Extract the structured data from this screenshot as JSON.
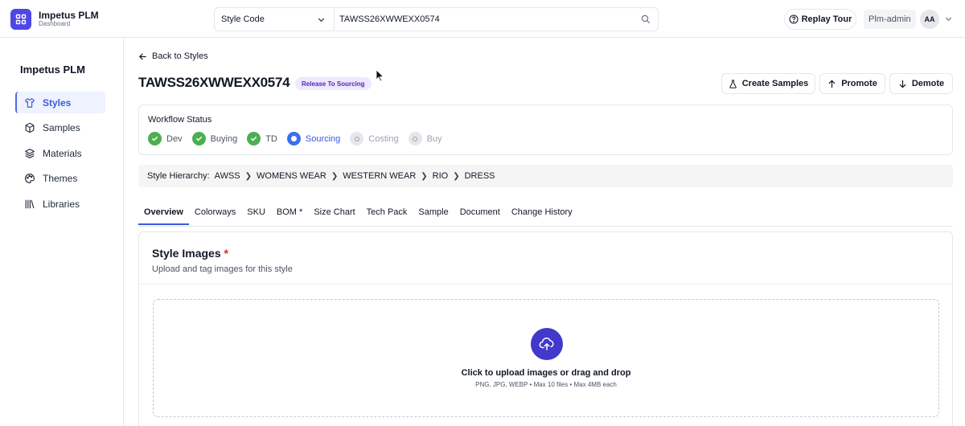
{
  "app": {
    "title": "Impetus PLM",
    "subtitle": "Dashboard"
  },
  "search": {
    "type_selected": "Style Code",
    "value": "TAWSS26XWWEXX0574"
  },
  "header": {
    "replay_tour": "Replay Tour",
    "user_role": "Plm-admin",
    "avatar_initials": "AA"
  },
  "sidebar": {
    "title": "Impetus PLM",
    "items": [
      {
        "label": "Styles",
        "icon": "shirt-icon",
        "active": true
      },
      {
        "label": "Samples",
        "icon": "box-icon",
        "active": false
      },
      {
        "label": "Materials",
        "icon": "layers-icon",
        "active": false
      },
      {
        "label": "Themes",
        "icon": "palette-icon",
        "active": false
      },
      {
        "label": "Libraries",
        "icon": "library-icon",
        "active": false
      }
    ]
  },
  "page": {
    "back_label": "Back to Styles",
    "style_code": "TAWSS26XWWEXX0574",
    "status": "Release To Sourcing",
    "actions": {
      "create_samples": "Create Samples",
      "promote": "Promote",
      "demote": "Demote"
    }
  },
  "workflow": {
    "title": "Workflow Status",
    "steps": [
      {
        "label": "Dev",
        "state": "done"
      },
      {
        "label": "Buying",
        "state": "done"
      },
      {
        "label": "TD",
        "state": "done"
      },
      {
        "label": "Sourcing",
        "state": "current"
      },
      {
        "label": "Costing",
        "state": "todo"
      },
      {
        "label": "Buy",
        "state": "todo"
      }
    ]
  },
  "hierarchy": {
    "label": "Style Hierarchy:",
    "path": [
      "AWSS",
      "WOMENS WEAR",
      "WESTERN WEAR",
      "RIO",
      "DRESS"
    ]
  },
  "tabs": [
    "Overview",
    "Colorways",
    "SKU",
    "BOM *",
    "Size Chart",
    "Tech Pack",
    "Sample",
    "Document",
    "Change History"
  ],
  "active_tab": "Overview",
  "images": {
    "title": "Style Images",
    "required_mark": "*",
    "subtitle": "Upload and tag images for this style",
    "upload_text": "Click to upload images or drag and drop",
    "upload_hint": "PNG, JPG, WEBP • Max 10 files • Max 4MB each"
  },
  "colors": {
    "accent": "#3b5bdb",
    "brand": "#4f46e5",
    "success": "#4caf50",
    "upload": "#4338ca"
  }
}
